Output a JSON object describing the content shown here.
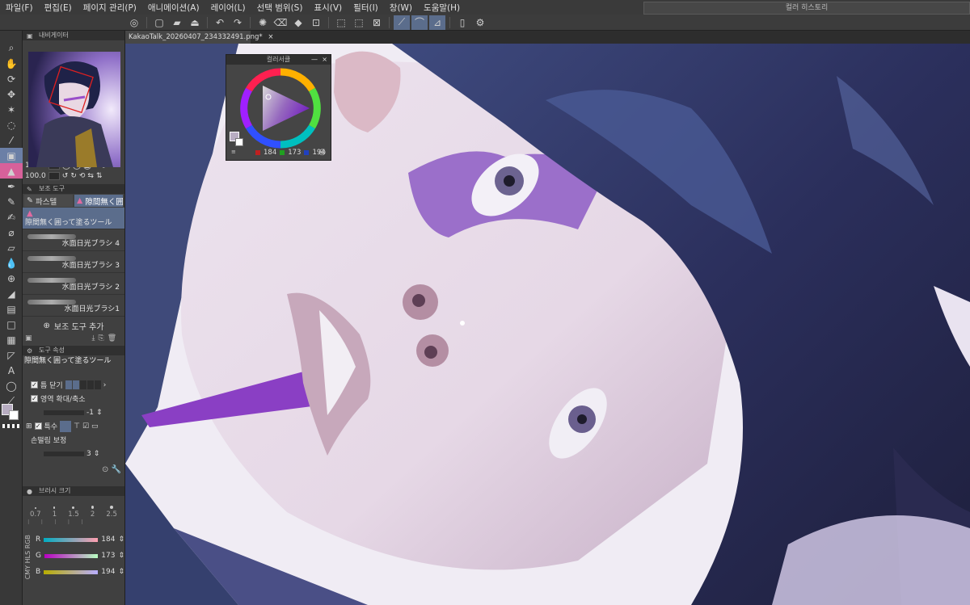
{
  "menu": [
    "파일(F)",
    "편집(E)",
    "페이지 관리(P)",
    "애니메이션(A)",
    "레이어(L)",
    "선택 범위(S)",
    "표시(V)",
    "필터(I)",
    "창(W)",
    "도움말(H)"
  ],
  "history_panel": {
    "title": "컬러 히스토리"
  },
  "document": {
    "tab_title": "KakaoTalk_20260407_234332491.png*",
    "close": "×"
  },
  "navigator": {
    "title": "내비게이터",
    "zoom": "133.1",
    "rotation": "100.0"
  },
  "sub_tool": {
    "title": "보조 도구",
    "groups": [
      {
        "label": "파스텔"
      },
      {
        "label": "隙間無く囲"
      }
    ],
    "items": [
      {
        "label": "隙間無く囲って塗るツール",
        "selected": true
      },
      {
        "label": "水面日光ブラシ 4"
      },
      {
        "label": "水面日光ブラシ 3"
      },
      {
        "label": "水面日光ブラシ 2"
      },
      {
        "label": "水面日光ブラシ1"
      }
    ],
    "add_label": "보조 도구 추가"
  },
  "tool_property": {
    "title": "도구 속성",
    "tool_name": "隙間無く囲って塗るツール",
    "close_gap": {
      "label": "틈 닫기",
      "checked": true
    },
    "area_scale": {
      "label": "영역 확대/축소",
      "checked": true,
      "value": "-1"
    },
    "special": {
      "label": "특수",
      "checked": true
    },
    "stabilization": {
      "label": "손떨림 보정",
      "value": "3"
    }
  },
  "brush_size": {
    "title": "브러시 크기",
    "presets": [
      "0.7",
      "1",
      "1.5",
      "2",
      "2.5"
    ]
  },
  "color_slider": {
    "mode": "RGB",
    "side_tabs": [
      "RGB",
      "HLS",
      "CMY"
    ],
    "channels": [
      {
        "label": "R",
        "value": "184"
      },
      {
        "label": "G",
        "value": "173"
      },
      {
        "label": "B",
        "value": "194"
      }
    ]
  },
  "color_circle": {
    "title": "컬러서클",
    "close": "×",
    "r": "184",
    "g": "173",
    "b": "194"
  },
  "colors": {
    "main": "#b8adc2",
    "sub": "#ffffff",
    "accent": "#5b6d8c"
  }
}
